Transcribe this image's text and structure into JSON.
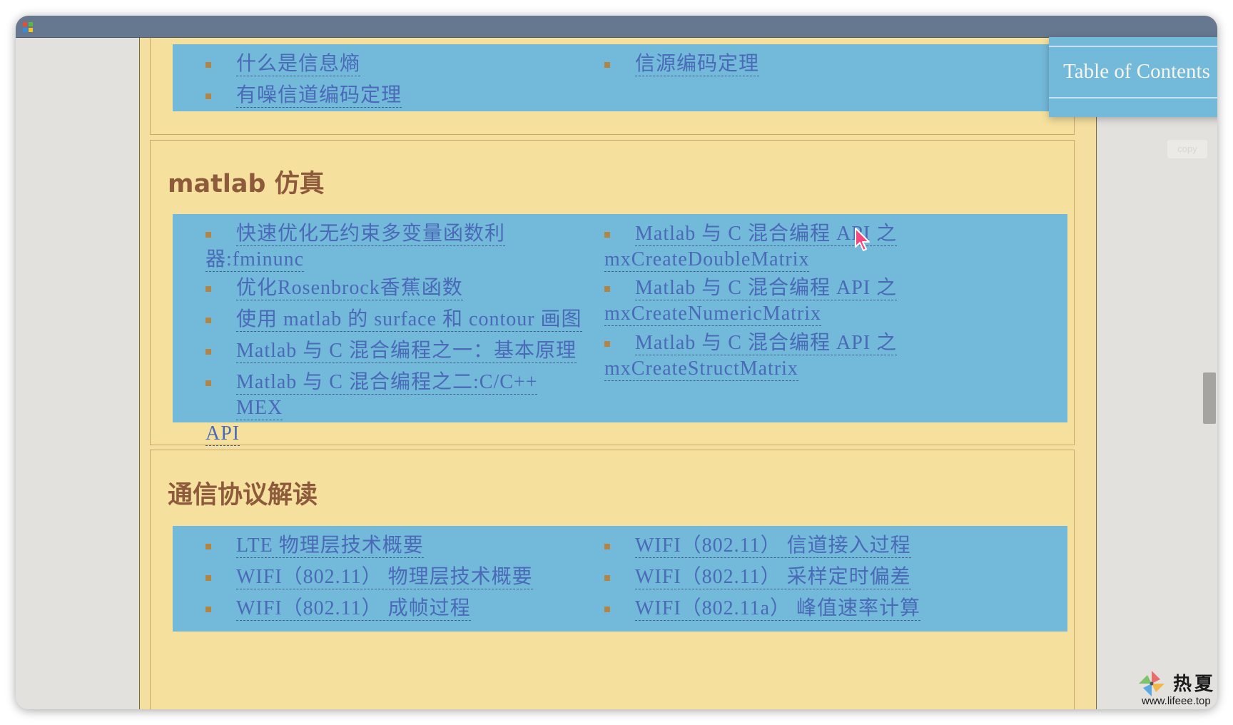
{
  "toc": {
    "title": "Table of Contents",
    "copy_label": "copy"
  },
  "sections": [
    {
      "title": "",
      "items": [
        "什么是信息熵",
        "有噪信道编码定理",
        "信源编码定理"
      ]
    },
    {
      "title": "matlab 仿真",
      "items": [
        "快速优化无约束多变量函数利",
        "器:fminunc",
        "优化Rosenbrock香蕉函数",
        "使用 matlab 的 surface 和 contour 画图",
        "Matlab 与 C 混合编程之一：基本原理",
        "Matlab 与 C 混合编程之二:C/C++ MEX",
        "API",
        "Matlab 与 C 混合编程 API 之",
        "mxCreateDoubleMatrix",
        "Matlab 与 C 混合编程 API 之",
        "mxCreateNumericMatrix",
        "Matlab 与 C 混合编程 API 之",
        "mxCreateStructMatrix"
      ]
    },
    {
      "title": "通信协议解读",
      "items": [
        "LTE 物理层技术概要",
        "WIFI（802.11） 物理层技术概要",
        "WIFI（802.11） 成帧过程",
        "WIFI（802.11） 信道接入过程",
        "WIFI（802.11） 采样定时偏差",
        "WIFI（802.11a） 峰值速率计算"
      ]
    }
  ],
  "watermark": {
    "brand": "热夏",
    "url": "www.lifeee.top"
  },
  "colors": {
    "page_background": "#f4dfa0",
    "panel_blue": "#73b9d9",
    "heading_brown": "#8d5b3c",
    "link_blue": "#4a6ab8",
    "titlebar": "#66788f"
  }
}
